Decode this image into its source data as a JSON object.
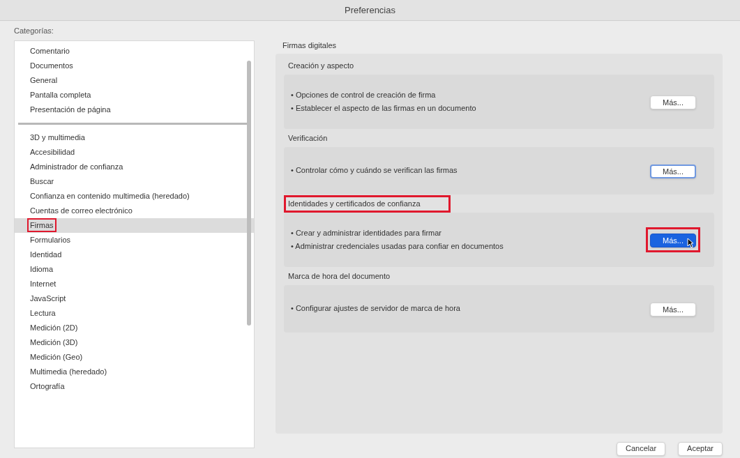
{
  "window": {
    "title": "Preferencias"
  },
  "categories": {
    "label": "Categorías:",
    "groups": [
      {
        "items": [
          {
            "label": "Comentario",
            "selected": false,
            "highlighted": false
          },
          {
            "label": "Documentos",
            "selected": false,
            "highlighted": false
          },
          {
            "label": "General",
            "selected": false,
            "highlighted": false
          },
          {
            "label": "Pantalla completa",
            "selected": false,
            "highlighted": false
          },
          {
            "label": "Presentación de página",
            "selected": false,
            "highlighted": false
          }
        ]
      },
      {
        "items": [
          {
            "label": "3D y multimedia",
            "selected": false,
            "highlighted": false
          },
          {
            "label": "Accesibilidad",
            "selected": false,
            "highlighted": false
          },
          {
            "label": "Administrador de confianza",
            "selected": false,
            "highlighted": false
          },
          {
            "label": "Buscar",
            "selected": false,
            "highlighted": false
          },
          {
            "label": "Confianza en contenido multimedia (heredado)",
            "selected": false,
            "highlighted": false
          },
          {
            "label": "Cuentas de correo electrónico",
            "selected": false,
            "highlighted": false
          },
          {
            "label": "Firmas",
            "selected": true,
            "highlighted": true
          },
          {
            "label": "Formularios",
            "selected": false,
            "highlighted": false
          },
          {
            "label": "Identidad",
            "selected": false,
            "highlighted": false
          },
          {
            "label": "Idioma",
            "selected": false,
            "highlighted": false
          },
          {
            "label": "Internet",
            "selected": false,
            "highlighted": false
          },
          {
            "label": "JavaScript",
            "selected": false,
            "highlighted": false
          },
          {
            "label": "Lectura",
            "selected": false,
            "highlighted": false
          },
          {
            "label": "Medición (2D)",
            "selected": false,
            "highlighted": false
          },
          {
            "label": "Medición (3D)",
            "selected": false,
            "highlighted": false
          },
          {
            "label": "Medición (Geo)",
            "selected": false,
            "highlighted": false
          },
          {
            "label": "Multimedia (heredado)",
            "selected": false,
            "highlighted": false
          },
          {
            "label": "Ortografía",
            "selected": false,
            "highlighted": false
          }
        ]
      }
    ]
  },
  "panel": {
    "title": "Firmas digitales",
    "sections": [
      {
        "title": "Creación y aspecto",
        "highlighted": false,
        "bullets": [
          "• Opciones de control de creación de firma",
          "• Establecer el aspecto de las firmas en un documento"
        ],
        "button": {
          "label": "Más...",
          "kind": "default",
          "highlighted": false
        }
      },
      {
        "title": "Verificación",
        "highlighted": false,
        "bullets": [
          "• Controlar cómo y cuándo se verifican las firmas"
        ],
        "button": {
          "label": "Más...",
          "kind": "focused",
          "highlighted": false
        }
      },
      {
        "title": "Identidades y certificados de confianza",
        "highlighted": true,
        "bullets": [
          "• Crear y administrar identidades para firmar",
          "• Administrar credenciales usadas para confiar en documentos"
        ],
        "button": {
          "label": "Más...",
          "kind": "primary",
          "highlighted": true
        }
      },
      {
        "title": "Marca de hora del documento",
        "highlighted": false,
        "bullets": [
          "• Configurar ajustes de servidor de marca de hora"
        ],
        "button": {
          "label": "Más...",
          "kind": "default",
          "highlighted": false
        }
      }
    ]
  },
  "footer": {
    "buttons": [
      "Cancelar",
      "Aceptar"
    ]
  }
}
